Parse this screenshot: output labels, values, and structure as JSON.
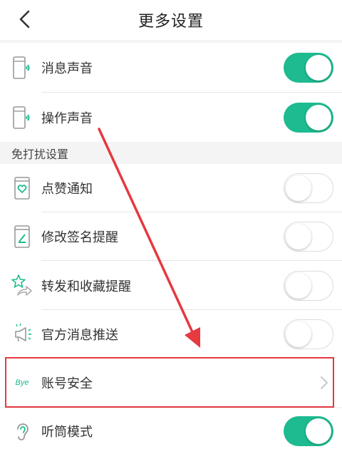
{
  "header": {
    "title": "更多设置"
  },
  "rows_top": [
    {
      "label": "消息声音",
      "on": true,
      "icon": "phone-sound-icon"
    },
    {
      "label": "操作声音",
      "on": true,
      "icon": "phone-sound-icon"
    }
  ],
  "section": {
    "title": "免打扰设置"
  },
  "rows_dnd": [
    {
      "label": "点赞通知",
      "on": false,
      "icon": "heart-phone-icon"
    },
    {
      "label": "修改签名提醒",
      "on": false,
      "icon": "edit-phone-icon"
    },
    {
      "label": "转发和收藏提醒",
      "on": false,
      "icon": "star-share-icon"
    },
    {
      "label": "官方消息推送",
      "on": false,
      "icon": "megaphone-icon"
    }
  ],
  "account": {
    "icon_text": "Bye",
    "label": "账号安全"
  },
  "earpiece": {
    "label": "听筒模式",
    "on": true,
    "icon": "ear-icon"
  },
  "colors": {
    "accent": "#1dbb8f",
    "highlight": "#e63940"
  }
}
